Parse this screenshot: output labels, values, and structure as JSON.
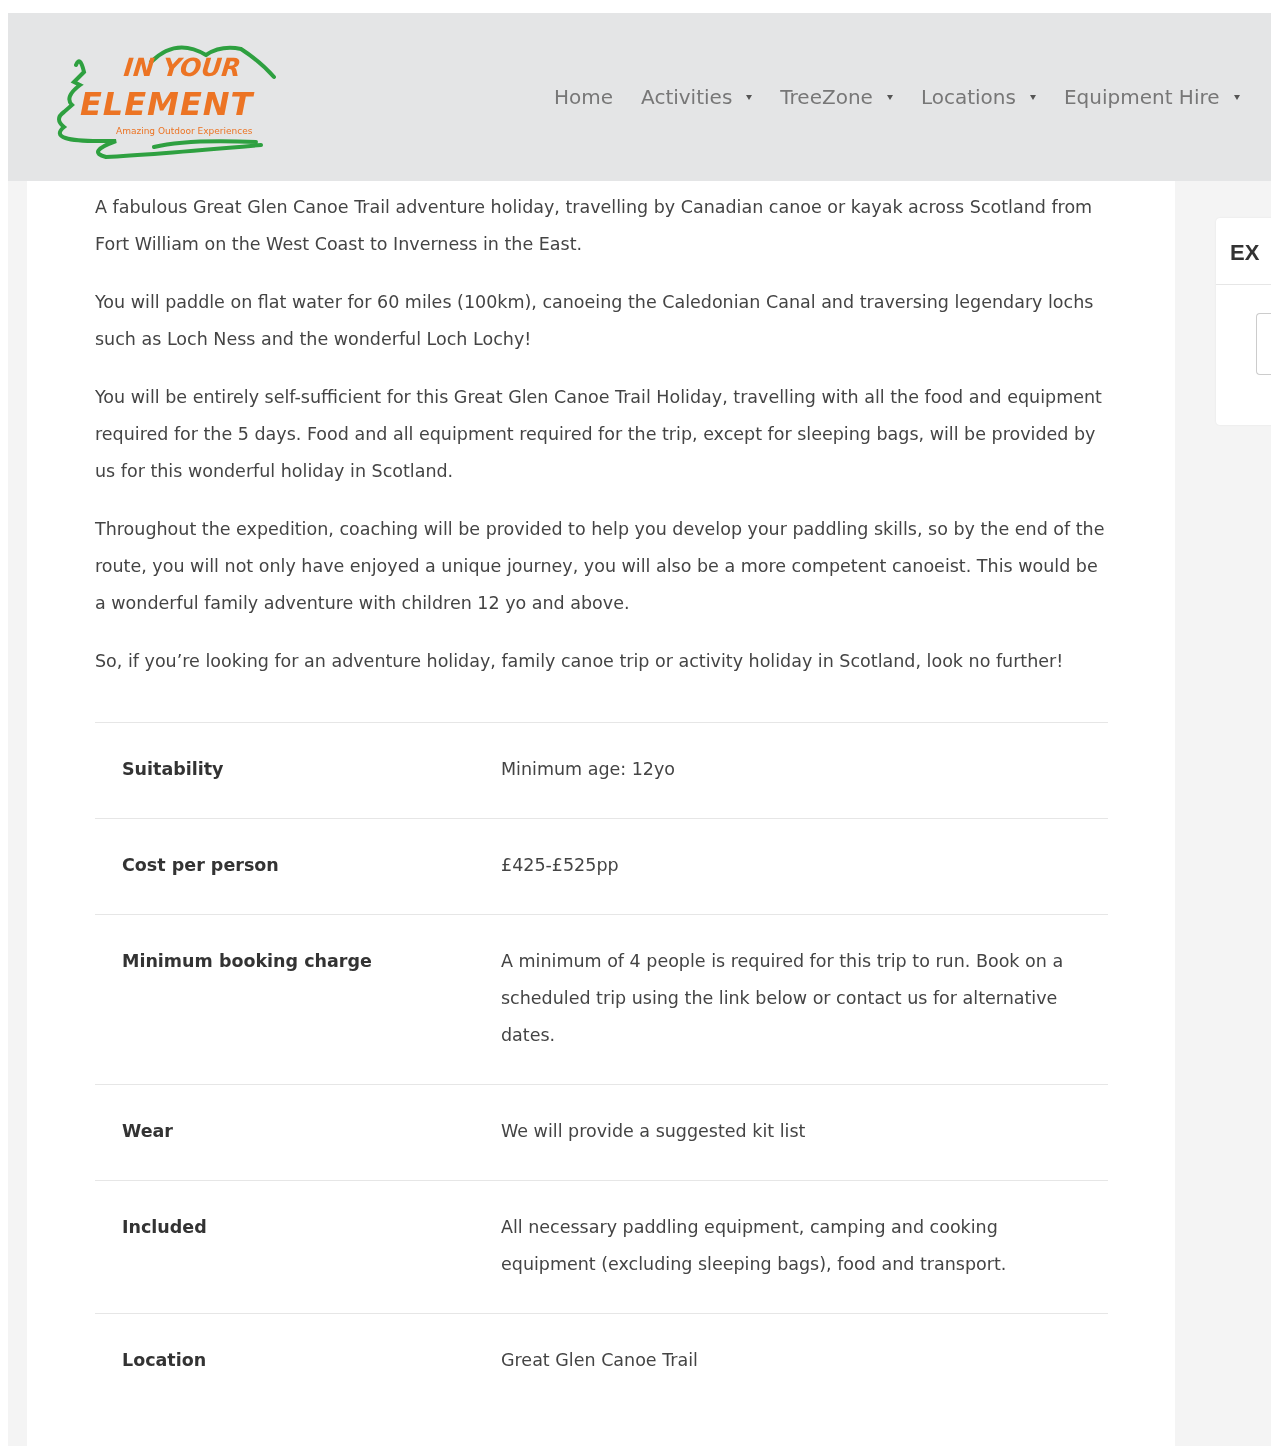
{
  "logo": {
    "line_1": "IN YOUR",
    "line_2": "ELEMENT",
    "tagline": "Amazing Outdoor Experiences"
  },
  "nav": [
    {
      "label": "Home",
      "has_dropdown": false
    },
    {
      "label": "Activities",
      "has_dropdown": true
    },
    {
      "label": "TreeZone",
      "has_dropdown": true
    },
    {
      "label": "Locations",
      "has_dropdown": true
    },
    {
      "label": "Equipment Hire",
      "has_dropdown": true
    }
  ],
  "paragraphs": [
    "A fabulous Great Glen Canoe Trail adventure holiday, travelling by Canadian canoe or kayak across Scotland from Fort William on the West Coast to Inverness in the East.",
    "You will paddle on flat water for 60 miles (100km), canoeing the Caledonian Canal and traversing legendary lochs such as Loch Ness and the wonderful Loch Lochy!",
    "You will be entirely self-sufficient for this Great Glen Canoe Trail Holiday, travelling with all the food and equipment required for the 5 days. Food and all equipment required for the trip, except for sleeping bags, will be provided by us for this wonderful holiday in Scotland.",
    "Throughout the expedition, coaching will be provided to help you develop your paddling skills, so by the end of the route, you will not only have enjoyed a unique journey, you will also be a more competent canoeist.  This would be a wonderful family adventure with children 12 yo and above.",
    "So, if you’re looking for an adventure holiday, family canoe trip or activity holiday in Scotland, look no further!"
  ],
  "details": [
    {
      "label": "Suitability",
      "value": "Minimum age: 12yo"
    },
    {
      "label": "Cost per person",
      "value": "£425-£525pp"
    },
    {
      "label": "Minimum booking charge",
      "value": "A minimum of 4 people is required for this trip to run. Book on a scheduled trip using the link below or contact us for alternative dates."
    },
    {
      "label": "Wear",
      "value": "We will provide a suggested kit list"
    },
    {
      "label": "Included",
      "value": "All necessary paddling equipment, camping and cooking equipment (excluding sleeping bags), food and transport."
    },
    {
      "label": "Location",
      "value": "Great Glen Canoe Trail"
    }
  ],
  "sidebar": {
    "heading": "EX"
  }
}
